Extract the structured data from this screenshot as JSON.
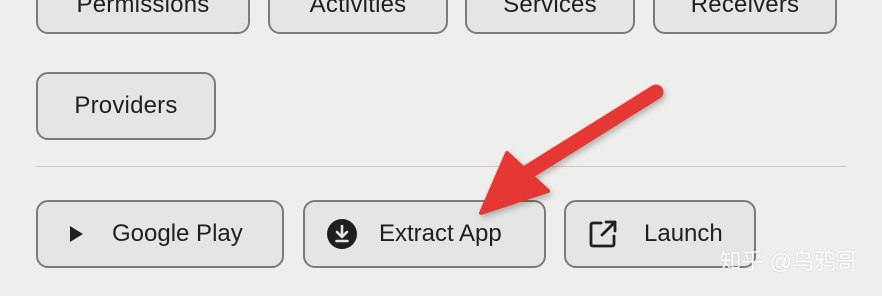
{
  "tags": {
    "row1": [
      "Permissions",
      "Activities",
      "Services",
      "Receivers"
    ],
    "providers": "Providers"
  },
  "actions": {
    "google_play": {
      "label": "Google Play",
      "icon": "play-icon"
    },
    "extract_app": {
      "label": "Extract App",
      "icon": "download-icon"
    },
    "launch": {
      "label": "Launch",
      "icon": "open-external-icon"
    }
  },
  "annotation": {
    "arrow_color": "#e53935",
    "arrow_points_to": "Extract App"
  },
  "watermark": "知乎 @乌鸦哥",
  "colors": {
    "background": "#eeeeec",
    "chip_background": "#e5e5e3",
    "chip_border": "#7b7b7b",
    "text": "#1f1f1f"
  }
}
